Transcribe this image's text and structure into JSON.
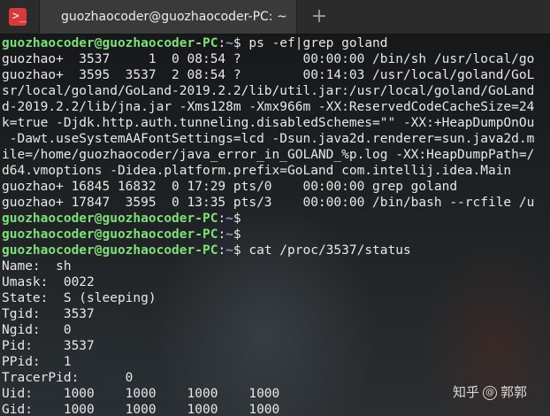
{
  "window": {
    "tab_title": "guozhaocoder@guozhaocoder-PC: ~",
    "new_tab_symbol": "+",
    "app_icon_glyph": ">_"
  },
  "prompt": {
    "user_host": "guozhaocoder@guozhaocoder-PC",
    "path": "~",
    "symbol": "$"
  },
  "terminal": {
    "commands": [
      "ps -ef|grep goland",
      "",
      "",
      "cat /proc/3537/status"
    ],
    "output_ps": [
      "guozhao+  3537     1  0 08:54 ?        00:00:00 /bin/sh /usr/local/go",
      "guozhao+  3595  3537  2 08:54 ?        00:14:03 /usr/local/goland/GoL",
      "sr/local/goland/GoLand-2019.2.2/lib/util.jar:/usr/local/goland/GoLand",
      "d-2019.2.2/lib/jna.jar -Xms128m -Xmx966m -XX:ReservedCodeCacheSize=24",
      "k=true -Djdk.http.auth.tunneling.disabledSchemes=\"\" -XX:+HeapDumpOnOu",
      " -Dawt.useSystemAAFontSettings=lcd -Dsun.java2d.renderer=sun.java2d.m",
      "ile=/home/guozhaocoder/java_error_in_GOLAND_%p.log -XX:HeapDumpPath=/",
      "d64.vmoptions -Didea.platform.prefix=GoLand com.intellij.idea.Main",
      "guozhao+ 16845 16832  0 17:29 pts/0    00:00:00 grep goland",
      "guozhao+ 17847  3595  0 13:35 pts/3    00:00:00 /bin/bash --rcfile /u"
    ],
    "output_status": [
      "Name:  sh",
      "Umask:  0022",
      "State:  S (sleeping)",
      "Tgid:   3537",
      "Ngid:   0",
      "Pid:    3537",
      "PPid:   1",
      "TracerPid:      0",
      "Uid:    1000    1000    1000    1000",
      "Gid:    1000    1000    1000    1000"
    ]
  },
  "watermark": {
    "left": "知乎",
    "at": "@",
    "right": "郭郭"
  },
  "colors": {
    "user_host": "#7ee07a",
    "path": "#6b9bf2",
    "text": "#e8e8e8",
    "icon_bg": "#d83a3a"
  }
}
